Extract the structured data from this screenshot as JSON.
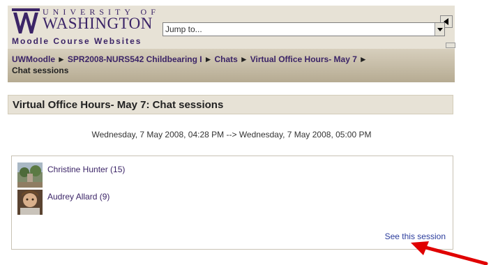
{
  "header": {
    "logo_university_line": "UNIVERSITY OF",
    "logo_washington": "WASHINGTON",
    "logo_subtitle": "Moodle Course Websites",
    "jump_select_value": "Jump to..."
  },
  "breadcrumb": {
    "items": [
      "UWMoodle",
      "SPR2008-NURS542 Childbearing I",
      "Chats",
      "Virtual Office Hours- May 7"
    ],
    "current": "Chat sessions",
    "separator": "►"
  },
  "main": {
    "title": "Virtual Office Hours- May 7: Chat sessions",
    "session_date_range": "Wednesday, 7 May 2008, 04:28 PM --> Wednesday, 7 May 2008, 05:00 PM",
    "participants": [
      {
        "name": "Christine Hunter (15)"
      },
      {
        "name": "Audrey Allard (9)"
      }
    ],
    "see_session_label": "See this session"
  },
  "colors": {
    "brand_purple": "#3b2467",
    "header_beige": "#e7e2d6",
    "crumb_tan": "#b6ab92",
    "link_blue": "#2b3c9c",
    "annotation_red": "#e00000"
  }
}
